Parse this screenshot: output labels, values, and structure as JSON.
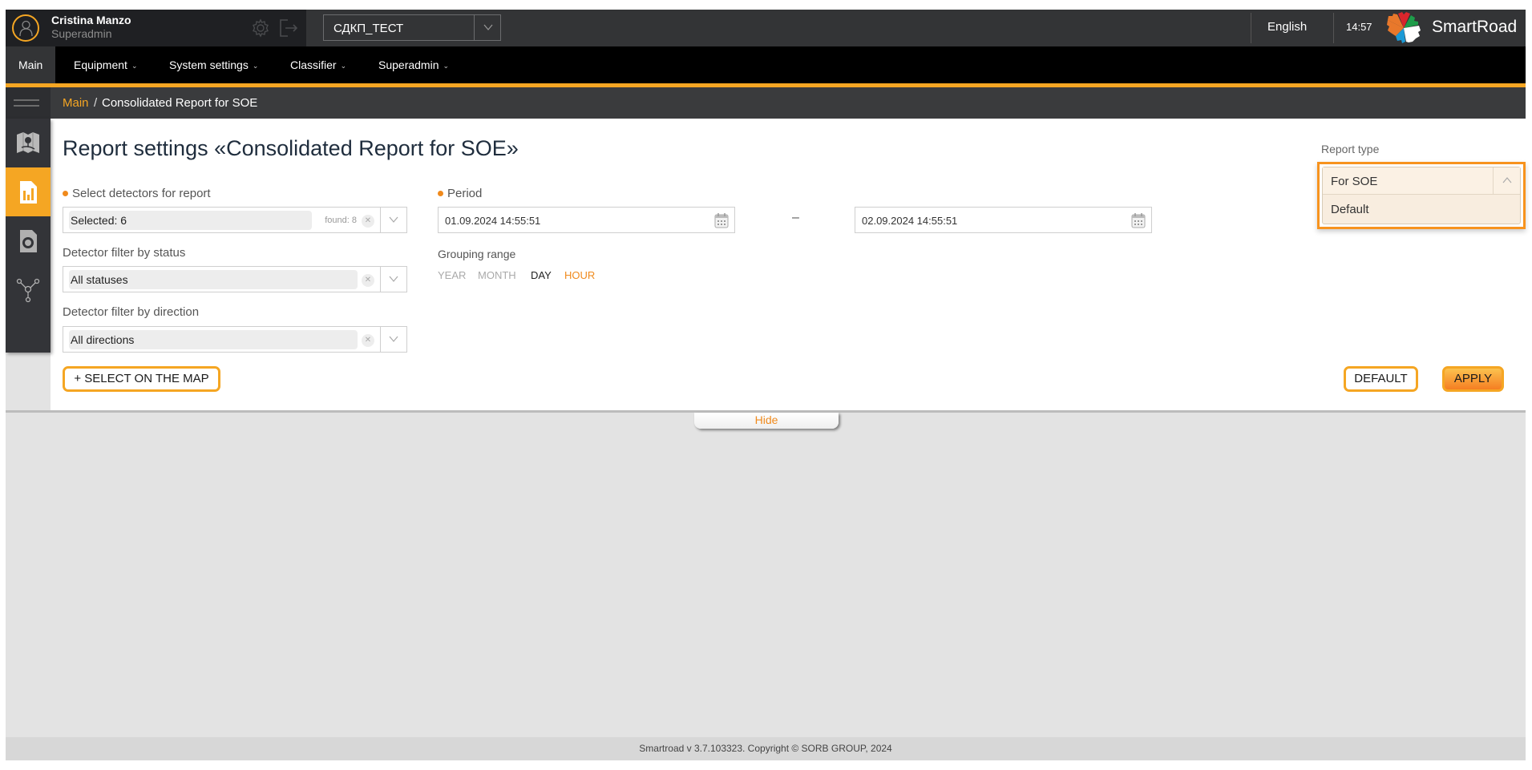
{
  "header": {
    "user_name": "Cristina Manzo",
    "user_role": "Superadmin",
    "project_select": "СДКП_ТЕСТ",
    "language": "English",
    "time": "14:57",
    "brand": "SmartRoad"
  },
  "nav": {
    "items": [
      {
        "label": "Main",
        "active": true,
        "dropdown": false
      },
      {
        "label": "Equipment",
        "dropdown": true
      },
      {
        "label": "System settings",
        "dropdown": true
      },
      {
        "label": "Classifier",
        "dropdown": true
      },
      {
        "label": "Superadmin",
        "dropdown": true
      }
    ],
    "chevron": "⌄"
  },
  "breadcrumb": {
    "root": "Main",
    "separator": "/",
    "current": "Consolidated Report for SOE"
  },
  "sidebar": {
    "items": [
      {
        "icon": "map-icon",
        "active": false
      },
      {
        "icon": "report-icon",
        "active": true
      },
      {
        "icon": "camera-detector-icon",
        "active": false
      },
      {
        "icon": "network-icon",
        "active": false
      }
    ]
  },
  "form": {
    "title": "Report settings «Consolidated Report for SOE»",
    "detectors": {
      "label": "Select detectors for report",
      "required": true,
      "value": "Selected: 6",
      "found": "found: 8"
    },
    "status_filter": {
      "label": "Detector filter by status",
      "value": "All statuses"
    },
    "direction_filter": {
      "label": "Detector filter by direction",
      "value": "All directions"
    },
    "period": {
      "label": "Period",
      "required": true,
      "from": "01.09.2024 14:55:51",
      "to": "02.09.2024 14:55:51",
      "separator": "–"
    },
    "grouping": {
      "label": "Grouping range",
      "options": [
        "YEAR",
        "MONTH",
        "DAY",
        "HOUR"
      ],
      "selected": "HOUR"
    },
    "report_type": {
      "label": "Report type",
      "selected": "For SOE",
      "options": [
        "For SOE",
        "Default"
      ]
    },
    "select_on_map_label": "+ SELECT ON THE MAP",
    "default_label": "DEFAULT",
    "apply_label": "APPLY",
    "hide_label": "Hide"
  },
  "footer": {
    "text": "Smartroad v 3.7.103323. Copyright © SORB GROUP, 2024"
  },
  "colors": {
    "accent": "#f5a623",
    "accent_text": "#f08a1c",
    "header_bg": "#333436",
    "nav_bg": "#000000"
  }
}
